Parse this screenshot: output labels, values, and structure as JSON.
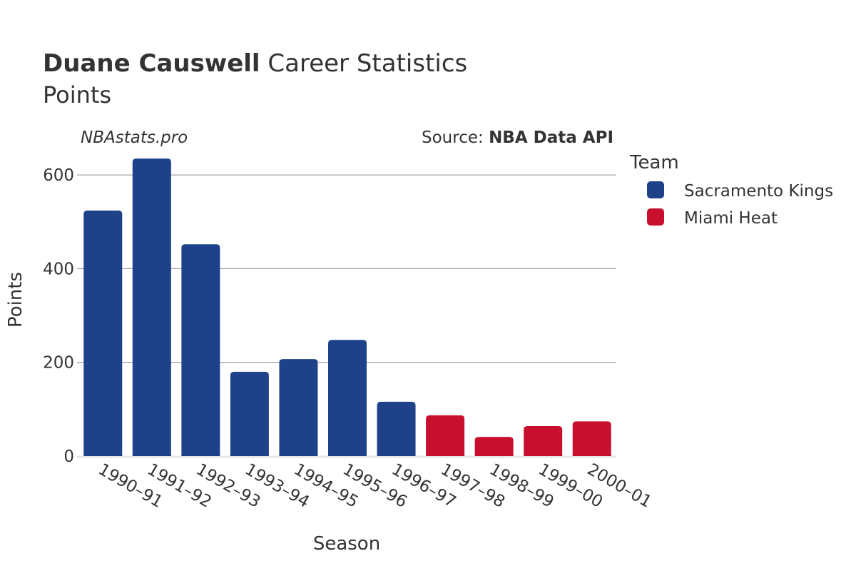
{
  "chart_data": {
    "type": "bar",
    "title_bold": "Duane Causwell",
    "title_rest": " Career Statistics",
    "subtitle": "Points",
    "watermark": "NBAstats.pro",
    "source_label": "Source: ",
    "source_name": "NBA Data API",
    "xlabel": "Season",
    "ylabel": "Points",
    "ylim": [
      0,
      660
    ],
    "yticks": [
      0,
      200,
      400,
      600
    ],
    "grid": true,
    "legend_title": "Team",
    "legend_position": "right",
    "categories": [
      "1990–91",
      "1991–92",
      "1992–93",
      "1993–94",
      "1994–95",
      "1995–96",
      "1996–97",
      "1997–98",
      "1998–99",
      "1999–00",
      "2000–01"
    ],
    "values": [
      524,
      635,
      452,
      180,
      207,
      248,
      116,
      87,
      41,
      64,
      74
    ],
    "teams": [
      "Sacramento Kings",
      "Sacramento Kings",
      "Sacramento Kings",
      "Sacramento Kings",
      "Sacramento Kings",
      "Sacramento Kings",
      "Sacramento Kings",
      "Miami Heat",
      "Miami Heat",
      "Miami Heat",
      "Miami Heat"
    ],
    "series": [
      {
        "name": "Sacramento Kings",
        "color": "#1d428a"
      },
      {
        "name": "Miami Heat",
        "color": "#c8102e"
      }
    ]
  }
}
